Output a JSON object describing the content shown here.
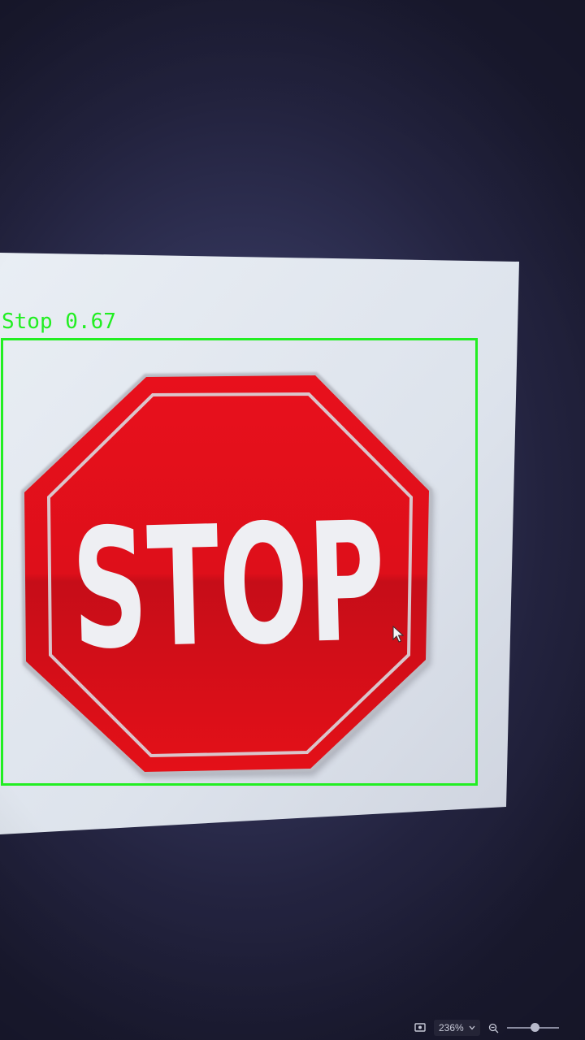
{
  "detection": {
    "label": "Stop 0.67",
    "box_color": "#22ee22"
  },
  "sign": {
    "text": "STOP",
    "fill_color": "#e0121c",
    "text_color": "#f2f2f4"
  },
  "viewer": {
    "zoom_level": "236%",
    "zoom_fraction": 0.55,
    "icons": [
      "screen-icon",
      "chevron-down-icon",
      "zoom-out-icon"
    ]
  }
}
